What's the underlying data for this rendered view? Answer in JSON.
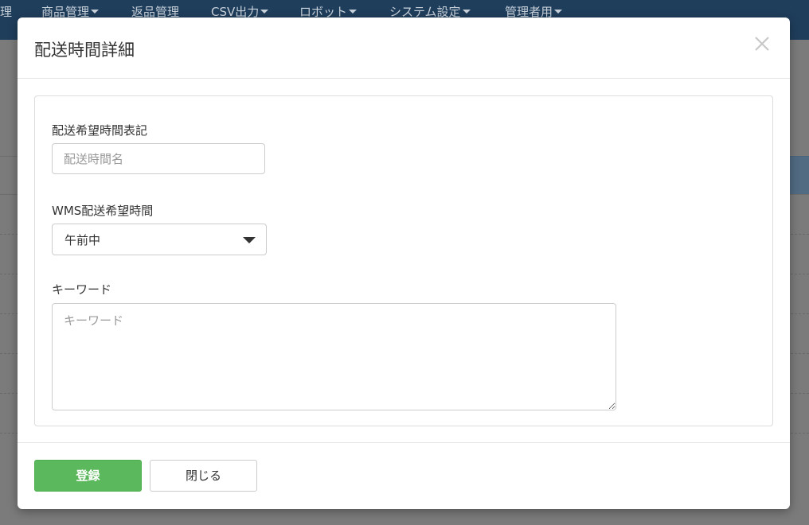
{
  "navbar": {
    "items": [
      {
        "label": "理",
        "has_caret": false
      },
      {
        "label": "商品管理",
        "has_caret": true
      },
      {
        "label": "返品管理",
        "has_caret": false
      },
      {
        "label": "CSV出力",
        "has_caret": true
      },
      {
        "label": "ロボット",
        "has_caret": true
      },
      {
        "label": "システム設定",
        "has_caret": true
      },
      {
        "label": "管理者用",
        "has_caret": true
      }
    ]
  },
  "modal": {
    "title": "配送時間詳細",
    "close_icon": "close-icon",
    "fields": {
      "display_name": {
        "label": "配送希望時間表記",
        "value": "",
        "placeholder": "配送時間名"
      },
      "wms_time": {
        "label": "WMS配送希望時間",
        "selected": "午前中",
        "icon": "chevron-down-icon"
      },
      "keyword": {
        "label": "キーワード",
        "value": "",
        "placeholder": "キーワード"
      }
    },
    "footer": {
      "register_label": "登録",
      "close_label": "閉じる"
    }
  },
  "colors": {
    "navbar": "#1f3e5c",
    "primary_button": "#5cb85c",
    "overlay": "#7b7b7b"
  }
}
